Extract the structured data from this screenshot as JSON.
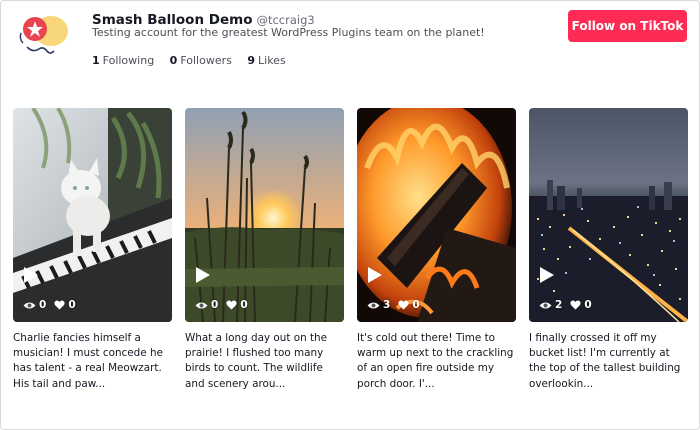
{
  "profile": {
    "display_name": "Smash Balloon Demo",
    "handle": "@tccraig3",
    "bio": "Testing account for the greatest WordPress Plugins team on the planet!",
    "stats": {
      "following_count": "1",
      "following_label": "Following",
      "followers_count": "0",
      "followers_label": "Followers",
      "likes_count": "9",
      "likes_label": "Likes"
    }
  },
  "follow_button": {
    "label": "Follow on TikTok",
    "color": "#fe2c55"
  },
  "videos": [
    {
      "views": "0",
      "likes": "0",
      "caption": "Charlie fancies himself a musician! I must concede he has talent - a real Meowzart. His tail and paw..."
    },
    {
      "views": "0",
      "likes": "0",
      "caption": "What a long day out on the prairie! I flushed too many birds to count. The wildlife and scenery arou..."
    },
    {
      "views": "3",
      "likes": "0",
      "caption": "It's cold out there! Time to warm up next to the crackling of an open fire outside my porch door. I'..."
    },
    {
      "views": "2",
      "likes": "0",
      "caption": "I finally crossed it off my bucket list! I'm currently at the top of the tallest building overlookin..."
    }
  ]
}
